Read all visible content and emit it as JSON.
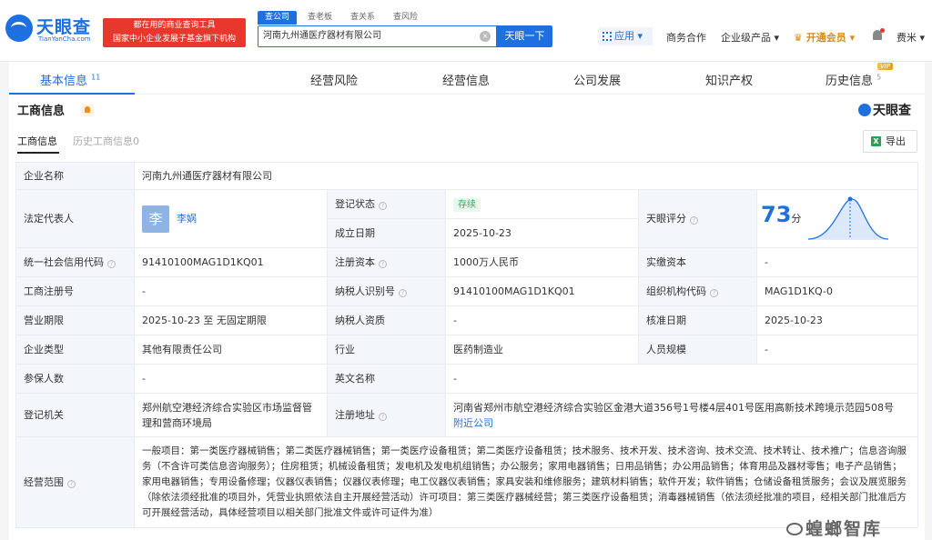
{
  "header": {
    "logo_text": "天眼查",
    "logo_sub": "TianYanCha.com",
    "slogan_line1": "都在用的商业查询工具",
    "slogan_line2": "国家中小企业发展子基金旗下机构",
    "search_tabs": [
      "查公司",
      "查老板",
      "查关系",
      "查风险"
    ],
    "search_value": "河南九州通医疗器材有限公司",
    "search_button": "天眼一下",
    "clear_glyph": "×",
    "nav_app": "应用",
    "nav_business": "商务合作",
    "nav_enterprise": "企业级产品",
    "nav_vip": "开通会员",
    "nav_user": "费米",
    "caret": "▾"
  },
  "tabs": {
    "items": [
      {
        "label": "基本信息",
        "count": "11"
      },
      {
        "label": "经营风险"
      },
      {
        "label": "经营信息"
      },
      {
        "label": "公司发展"
      },
      {
        "label": "知识产权"
      },
      {
        "label": "历史信息",
        "count": "5"
      }
    ],
    "vip_badge": "VIP"
  },
  "section": {
    "title": "工商信息",
    "watermark": "天眼查",
    "subtab_current": "工商信息",
    "subtab_history": "历史工商信息0",
    "export_label": "导出",
    "export_icon_glyph": "X"
  },
  "table": {
    "company_name_label": "企业名称",
    "company_name": "河南九州通医疗器材有限公司",
    "legal_rep_label": "法定代表人",
    "legal_rep_avatar": "李",
    "legal_rep": "李娲",
    "reg_status_label": "登记状态",
    "reg_status": "存续",
    "score_label": "天眼评分",
    "score_value": "73",
    "score_unit": "分",
    "established_label": "成立日期",
    "established": "2025-10-23",
    "credit_code_label": "统一社会信用代码",
    "credit_code": "91410100MAG1D1KQ01",
    "reg_capital_label": "注册资本",
    "reg_capital": "1000万人民币",
    "paid_capital_label": "实缴资本",
    "paid_capital": "-",
    "biz_reg_no_label": "工商注册号",
    "biz_reg_no": "-",
    "taxpayer_id_label": "纳税人识别号",
    "taxpayer_id": "91410100MAG1D1KQ01",
    "org_code_label": "组织机构代码",
    "org_code": "MAG1D1KQ-0",
    "term_label": "营业期限",
    "term": "2025-10-23 至 无固定期限",
    "tax_quality_label": "纳税人资质",
    "tax_quality": "-",
    "approval_date_label": "核准日期",
    "approval_date": "2025-10-23",
    "type_label": "企业类型",
    "type": "其他有限责任公司",
    "industry_label": "行业",
    "industry": "医药制造业",
    "staff_size_label": "人员规模",
    "staff_size": "-",
    "insured_label": "参保人数",
    "insured": "-",
    "english_name_label": "英文名称",
    "english_name": "-",
    "authority_label": "登记机关",
    "authority": "郑州航空港经济综合实验区市场监督管理和营商环境局",
    "address_label": "注册地址",
    "address": "河南省郑州市航空港经济综合实验区金港大道356号1号楼4层401号医用高新技术跨境示范园508号",
    "nearby_link": "附近公司",
    "scope_label": "经营范围",
    "scope": "一般项目：第一类医疗器械销售；第二类医疗器械销售；第一类医疗设备租赁；第二类医疗设备租赁；技术服务、技术开发、技术咨询、技术交流、技术转让、技术推广；信息咨询服务（不含许可类信息咨询服务）；住房租赁；机械设备租赁；发电机及发电机组销售；办公服务；家用电器销售；日用品销售；办公用品销售；体育用品及器材零售；电子产品销售；家用电器销售；专用设备修理；仪器仪表销售；仪器仪表修理；电工仪器仪表销售；家具安装和维修服务；建筑材料销售；软件开发；软件销售；仓储设备租赁服务；会议及展览服务（除依法须经批准的项目外，凭营业执照依法自主开展经营活动）许可项目：第三类医疗器械经营；第三类医疗设备租赁；消毒器械销售（依法须经批准的项目，经相关部门批准后方可开展经营活动，具体经营项目以相关部门批准文件或许可证件为准）"
  },
  "help_glyph": "?",
  "bottom_watermark": "蝗螂智库",
  "colors": {
    "accent": "#1e6fe0",
    "slogan": "#e8372d",
    "vip": "#d58c16",
    "status": "#2eac60"
  }
}
